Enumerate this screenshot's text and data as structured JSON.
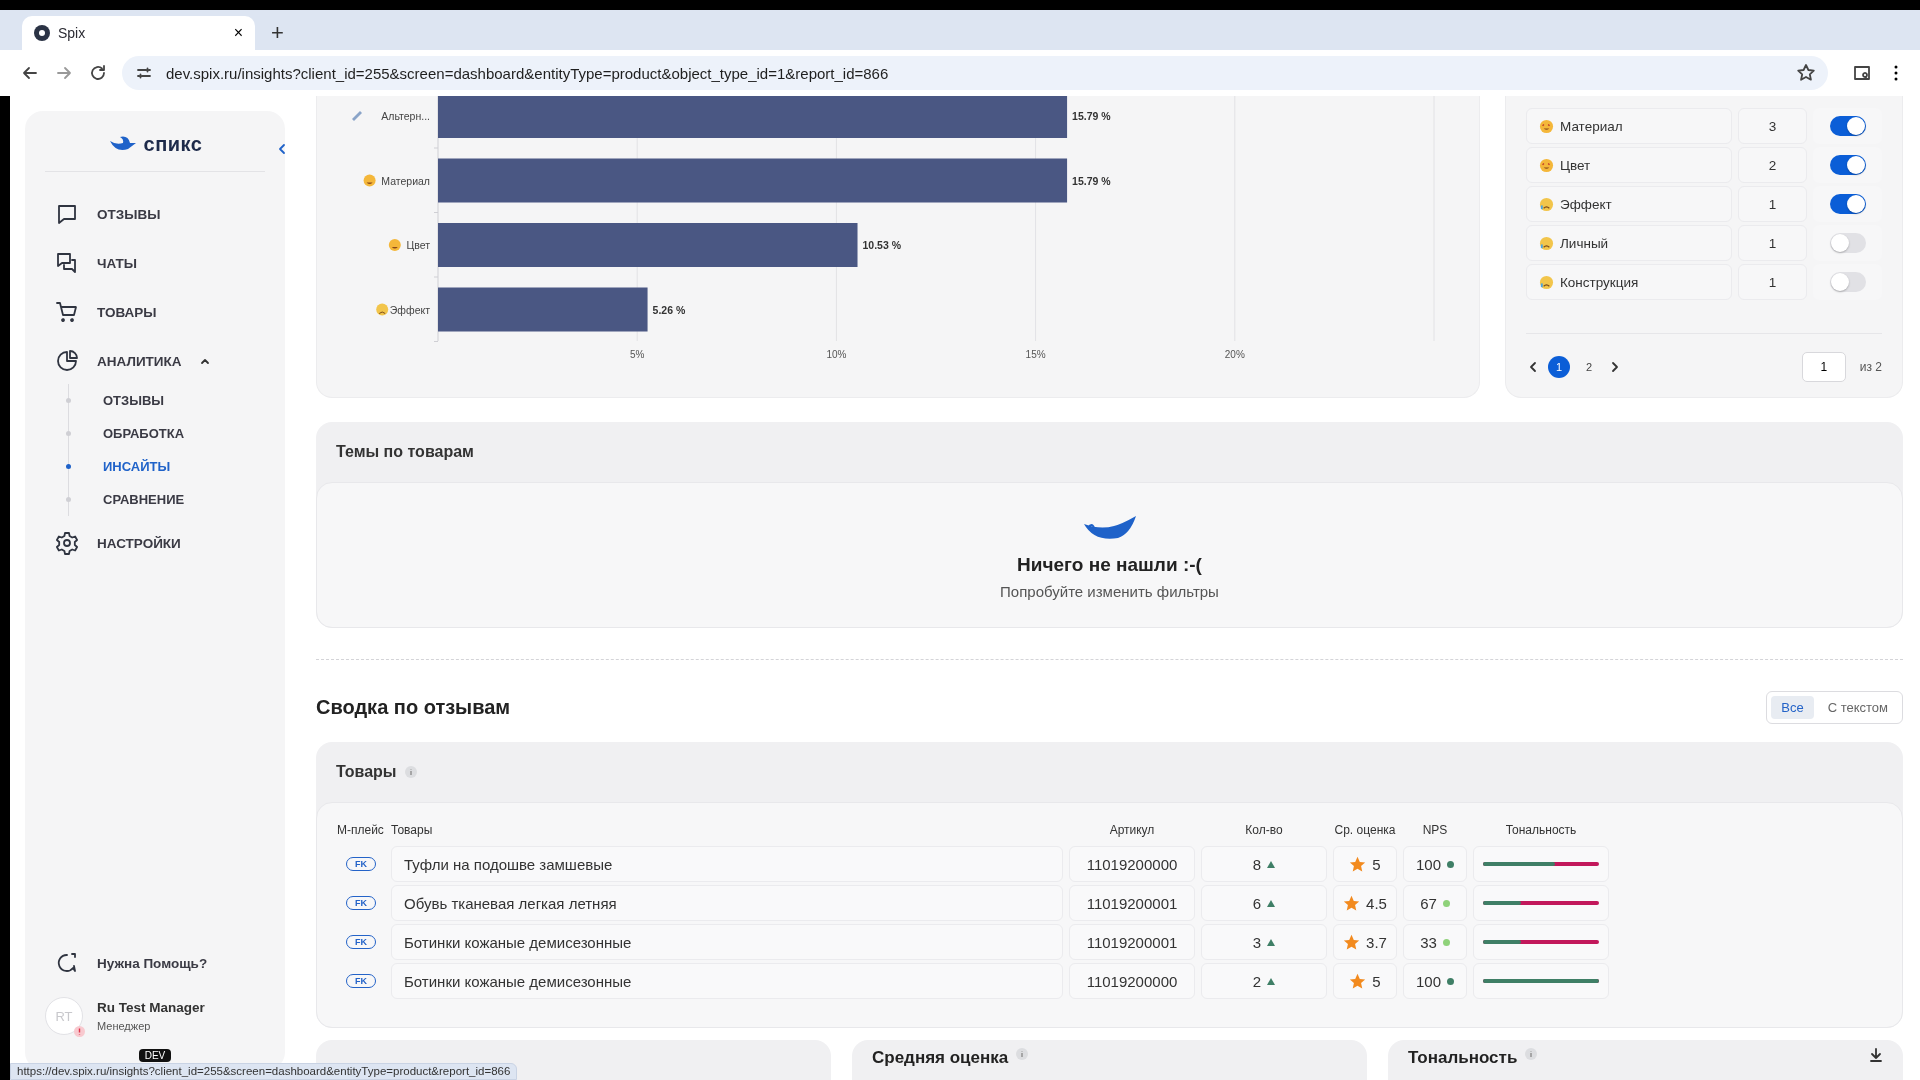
{
  "browser": {
    "tab_title": "Spix",
    "tab_close": "×",
    "new_tab": "+",
    "url": "dev.spix.ru/insights?client_id=255&screen=dashboard&entityType=product&object_type_id=1&report_id=866"
  },
  "sidebar": {
    "logo": "спикс",
    "nav": [
      {
        "label": "ОТЗЫВЫ",
        "selected": false
      },
      {
        "label": "ЧАТЫ",
        "selected": false
      },
      {
        "label": "ТОВАРЫ",
        "selected": false
      },
      {
        "label": "АНАЛИТИКА",
        "selected": false,
        "expanded": true,
        "children": [
          {
            "label": "ОТЗЫВЫ",
            "selected": false
          },
          {
            "label": "ОБРАБОТКА",
            "selected": false
          },
          {
            "label": "ИНСАЙТЫ",
            "selected": true
          },
          {
            "label": "СРАВНЕНИЕ",
            "selected": false
          }
        ]
      },
      {
        "label": "НАСТРОЙКИ",
        "selected": false
      }
    ],
    "help": "Нужна Помощь?",
    "user": {
      "initials": "RT",
      "name": "Ru Test Manager",
      "role": "Менеджер"
    },
    "env_badge": "DEV"
  },
  "topics_chart": {
    "category_icons": [
      {
        "kind": "neutral"
      },
      {
        "kind": "positive"
      },
      {
        "kind": "positive"
      },
      {
        "kind": "negative"
      }
    ],
    "chart_data": {
      "type": "bar",
      "orientation": "horizontal",
      "grid": true,
      "categories": [
        "Альтерн...",
        "Материал",
        "Цвет",
        "Эффект"
      ],
      "values": [
        15.79,
        15.79,
        10.53,
        5.26
      ],
      "xlim": [
        0,
        25
      ],
      "xticks": [
        {
          "value": 5,
          "label": "5%"
        },
        {
          "value": 10,
          "label": "10%"
        },
        {
          "value": 15,
          "label": "15%"
        },
        {
          "value": 20,
          "label": "20%"
        }
      ],
      "value_labels": [
        "15.79 %",
        "15.79 %",
        "10.53 %",
        "5.26 %"
      ]
    }
  },
  "topics_panel": {
    "rows": [
      {
        "kind": "positive",
        "name": "Материал",
        "count": "3",
        "on": true
      },
      {
        "kind": "positive",
        "name": "Цвет",
        "count": "2",
        "on": true
      },
      {
        "kind": "negative",
        "name": "Эффект",
        "count": "1",
        "on": true
      },
      {
        "kind": "negative",
        "name": "Личный",
        "count": "1",
        "on": false
      },
      {
        "kind": "negative",
        "name": "Конструкция",
        "count": "1",
        "on": false
      }
    ],
    "pages": [
      {
        "label": "1",
        "selected": true
      },
      {
        "label": "2",
        "selected": false
      }
    ],
    "page_input": "1",
    "page_total": "из 2"
  },
  "product_themes": {
    "title": "Темы по товарам",
    "empty_title": "Ничего не нашли :-(",
    "empty_hint": "Попробуйте изменить фильтры"
  },
  "summary": {
    "title": "Сводка по отзывам",
    "filter": [
      {
        "label": "Все",
        "selected": true
      },
      {
        "label": "С текстом",
        "selected": false
      }
    ]
  },
  "products": {
    "title": "Товары",
    "columns": [
      "М-плейс",
      "Товары",
      "Артикул",
      "Кол-во",
      "Ср. оценка",
      "NPS",
      "Тональность"
    ],
    "rows": [
      {
        "marketplace": "FK",
        "name": "Туфли на подошве замшевые",
        "article": "11019200000",
        "count": "8",
        "trend_up": true,
        "rating": "5",
        "nps": "100",
        "color": "#3f7f66",
        "level": 0.62
      },
      {
        "marketplace": "FK",
        "name": "Обувь тканевая легкая летняя",
        "article": "11019200001",
        "count": "6",
        "trend_up": true,
        "rating": "4.5",
        "nps": "67",
        "color": "#8fd27a",
        "level": 0.33
      },
      {
        "marketplace": "FK",
        "name": "Ботинки кожаные демисезонные",
        "article": "11019200001",
        "count": "3",
        "trend_up": true,
        "rating": "3.7",
        "nps": "33",
        "color": "#8fd27a",
        "level": 0.33
      },
      {
        "marketplace": "FK",
        "name": "Ботинки кожаные демисезонные",
        "article": "11019200000",
        "count": "2",
        "trend_up": true,
        "rating": "5",
        "nps": "100",
        "color": "#3f7f66",
        "level": 1
      }
    ]
  },
  "bottom_cards": [
    {
      "kind": "blank"
    },
    {
      "kind": "titled",
      "title": "Средняя оценка",
      "download": false
    },
    {
      "kind": "titled",
      "title": "Тональность",
      "download": true
    }
  ],
  "status_bubble": {
    "url": "https://dev.spix.ru/insights?client_id=255&screen=dashboard&entityType=product&report_id=866"
  }
}
